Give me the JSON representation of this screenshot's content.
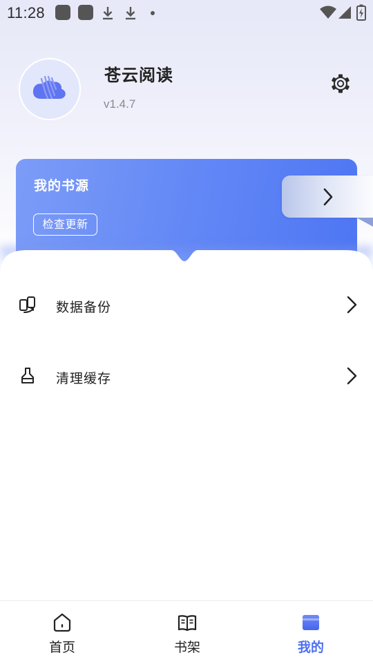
{
  "status_bar": {
    "time": "11:28",
    "icons": [
      "app-icon",
      "app-icon",
      "download-icon",
      "download-icon",
      "dot-icon",
      "wifi-icon",
      "signal-icon",
      "battery-icon"
    ]
  },
  "profile": {
    "app_name": "苍云阅读",
    "version": "v1.4.7",
    "avatar_icon": "cloud-book-logo-icon",
    "settings_icon": "gear-icon"
  },
  "source_card": {
    "title": "我的书源",
    "check_button": "检查更新",
    "arrow_icon": "chevron-right-icon"
  },
  "menu": [
    {
      "label": "数据备份",
      "icon": "backup-icon"
    },
    {
      "label": "清理缓存",
      "icon": "broom-icon"
    }
  ],
  "bottom_nav": {
    "items": [
      {
        "label": "首页",
        "icon": "home-icon",
        "active": false
      },
      {
        "label": "书架",
        "icon": "book-icon",
        "active": false
      },
      {
        "label": "我的",
        "icon": "profile-tab-icon",
        "active": true
      }
    ]
  },
  "colors": {
    "accent": "#4f6ff0",
    "card_gradient_start": "#7c9cf7",
    "card_gradient_end": "#4e76f3"
  }
}
